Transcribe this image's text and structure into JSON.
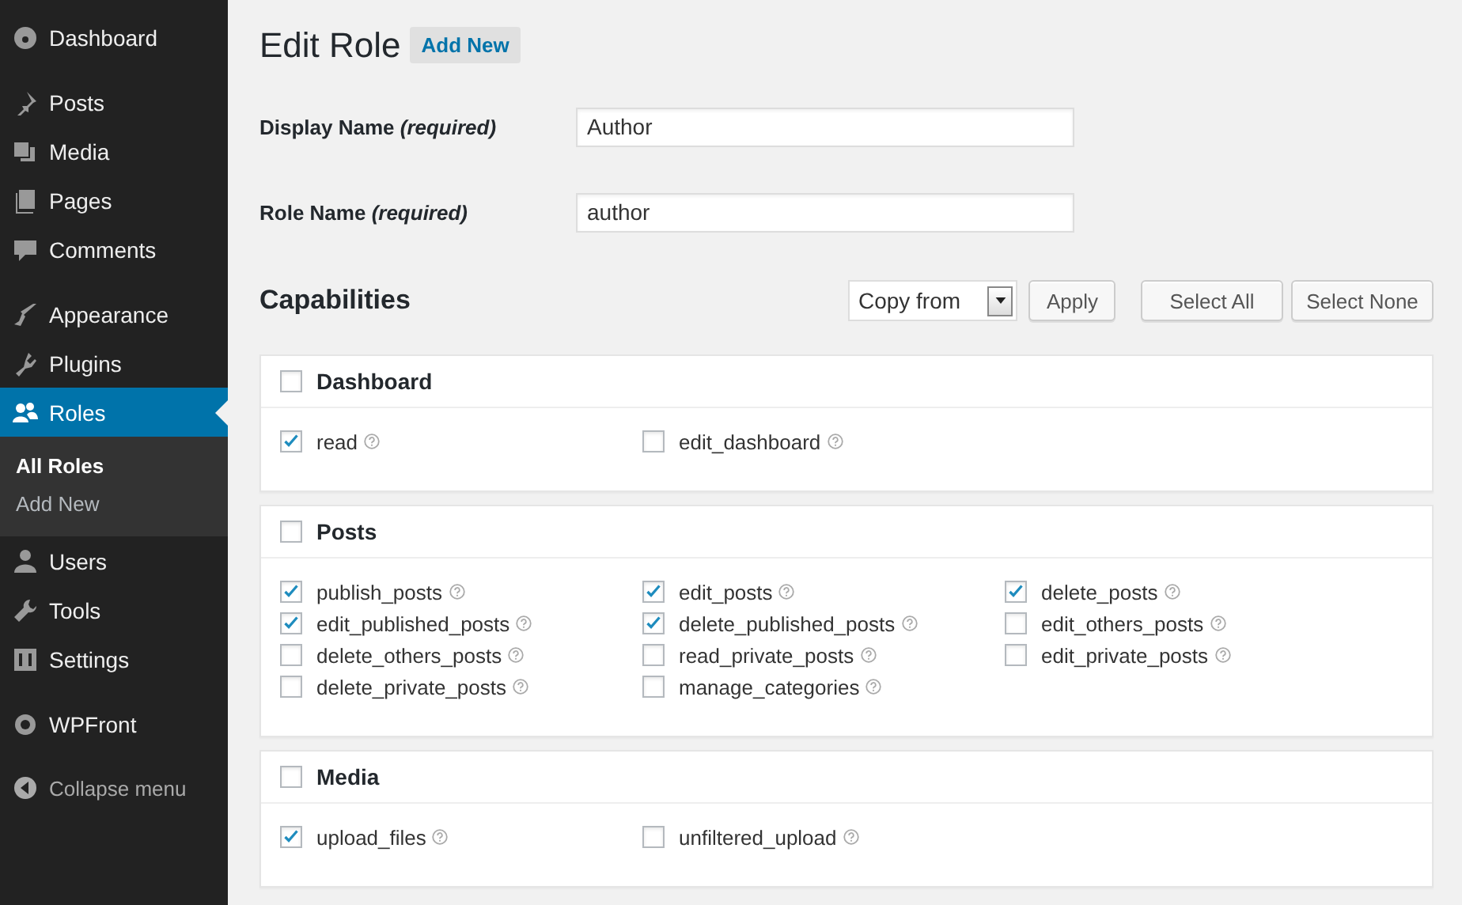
{
  "sidebar": {
    "groups": [
      {
        "items": [
          {
            "label": "Dashboard",
            "selected": false
          }
        ]
      },
      {
        "items": [
          {
            "label": "Posts",
            "selected": false
          },
          {
            "label": "Media",
            "selected": false
          },
          {
            "label": "Pages",
            "selected": false
          },
          {
            "label": "Comments",
            "selected": false
          }
        ]
      },
      {
        "items": [
          {
            "label": "Appearance",
            "selected": false
          },
          {
            "label": "Plugins",
            "selected": false
          },
          {
            "label": "Roles",
            "selected": true,
            "children": [
              {
                "label": "All Roles",
                "selected": true
              },
              {
                "label": "Add New",
                "selected": false
              }
            ]
          },
          {
            "label": "Users",
            "selected": false
          },
          {
            "label": "Tools",
            "selected": false
          },
          {
            "label": "Settings",
            "selected": false
          }
        ]
      },
      {
        "items": [
          {
            "label": "WPFront",
            "selected": false
          }
        ]
      }
    ],
    "collapse_button": "Collapse menu"
  },
  "page": {
    "title": "Edit Role",
    "add_new_button": "Add New",
    "fields": [
      {
        "label": "Display Name *(required)*",
        "value": "Author"
      },
      {
        "label": "Role Name *(required)*",
        "value": "author"
      }
    ],
    "capabilities": {
      "heading": "Capabilities",
      "copy_from": "Copy from",
      "apply_button": "Apply",
      "select_all_button": "Select All",
      "select_none_button": "Select None",
      "groups": [
        {
          "name": "Dashboard",
          "checked": false,
          "items": [
            {
              "name": "read",
              "checked": true
            },
            {
              "name": "edit_dashboard",
              "checked": false
            }
          ]
        },
        {
          "name": "Posts",
          "checked": false,
          "items": [
            {
              "name": "publish_posts",
              "checked": true
            },
            {
              "name": "edit_posts",
              "checked": true
            },
            {
              "name": "delete_posts",
              "checked": true
            },
            {
              "name": "edit_published_posts",
              "checked": true
            },
            {
              "name": "delete_published_posts",
              "checked": true
            },
            {
              "name": "edit_others_posts",
              "checked": false
            },
            {
              "name": "delete_others_posts",
              "checked": false
            },
            {
              "name": "read_private_posts",
              "checked": false
            },
            {
              "name": "edit_private_posts",
              "checked": false
            },
            {
              "name": "delete_private_posts",
              "checked": false
            },
            {
              "name": "manage_categories",
              "checked": false
            }
          ]
        },
        {
          "name": "Media",
          "checked": false,
          "items": [
            {
              "name": "upload_files",
              "checked": true
            },
            {
              "name": "unfiltered_upload",
              "checked": false
            }
          ]
        }
      ]
    }
  }
}
